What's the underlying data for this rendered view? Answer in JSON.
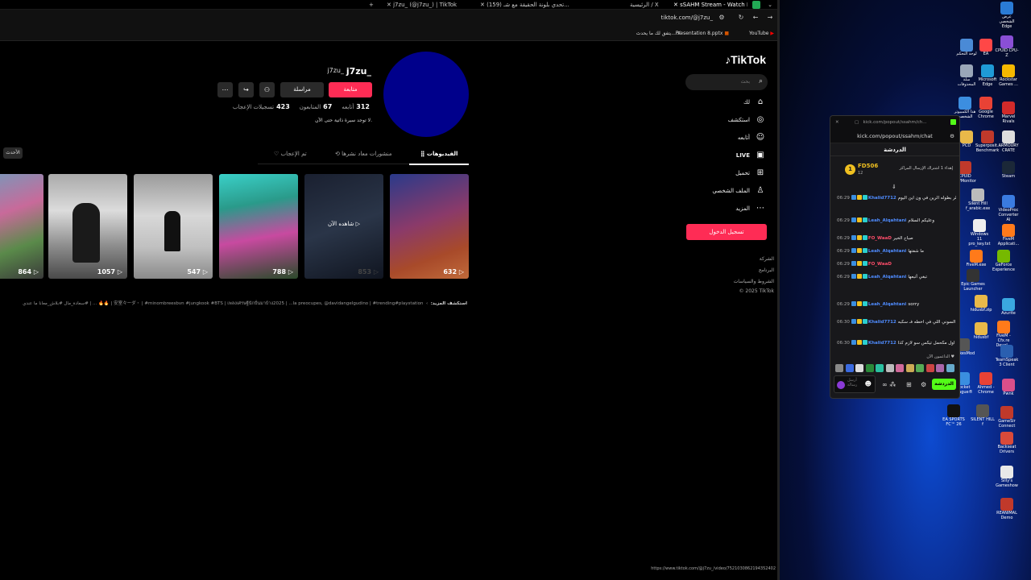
{
  "browser": {
    "tabs": [
      {
        "label": "j7zu_ (@j7zu_) | TikTok"
      },
      {
        "label": "(159) تحدي بلونة الحقيقة مع شـ..."
      },
      {
        "label": "الرئيسية / X"
      },
      {
        "label": "sSAHM Stream - Watch Live on"
      }
    ],
    "new_tab": "+",
    "url": "tiktok.com/@j7zu_",
    "bookmarks": [
      "YouTube",
      "Presentation 8.pptx",
      "يتفق لك ما يحدث..."
    ],
    "status_url": "https://www.tiktok.com/@j7zu_/video/7521030862194352402"
  },
  "tiktok": {
    "logo": "TikTok",
    "search_placeholder": "بحث",
    "nav": [
      {
        "label": "لك",
        "icon": "home-icon"
      },
      {
        "label": "استكشف",
        "icon": "compass-icon"
      },
      {
        "label": "أتابعه",
        "icon": "following-icon"
      },
      {
        "label": "LIVE",
        "icon": "live-icon"
      },
      {
        "label": "تحميل",
        "icon": "upload-icon"
      },
      {
        "label": "الملف الشخصي",
        "icon": "profile-icon"
      },
      {
        "label": "المزيد",
        "icon": "more-icon"
      }
    ],
    "login": "تسجيل الدخول",
    "footer": [
      "الشركة",
      "البرنامج",
      "الشروط والسياسات",
      "© 2025 TikTok"
    ],
    "profile": {
      "username": "j7zu_",
      "display_name": "j7zu_",
      "follow": "متابعة",
      "message": "مراسلة",
      "stats": [
        {
          "value": "312",
          "label": "أتابعه"
        },
        {
          "value": "67",
          "label": "المتابعون"
        },
        {
          "value": "423",
          "label": "تسجيلات الإعجاب"
        }
      ],
      "bio": "لا توجد سيرة ذاتية حتى الآن."
    },
    "tabs": [
      {
        "label": "الفيديوهات"
      },
      {
        "label": "منشورات معاد نشرها"
      },
      {
        "label": "تم الإعجاب"
      }
    ],
    "latest": "الأحدث",
    "videos": [
      {
        "views": "632",
        "overlay": ""
      },
      {
        "views": "853",
        "overlay": "شاهده الآن"
      },
      {
        "views": "788",
        "overlay": ""
      },
      {
        "views": "547",
        "overlay": ""
      },
      {
        "views": "1057",
        "overlay": ""
      },
      {
        "views": "864",
        "overlay": ""
      }
    ],
    "explore_label": "استكشف المزيد:",
    "explore_items": "安室々ーダ・ | #minombreesbvn #jungkook #BTS | เพลงเศรษฐีนักปั่นมาบ้าง2025 | ...la preocupes, @davidangelgudino | #trending#playstation | 🔥🔥 ... | #سعادة_مال #بلاش_معانا ما عندي"
  },
  "kick": {
    "title": "kick.com/popout/ssahm/ch...",
    "url": "kick.com/popout/ssahm/chat",
    "header": "الدردشة",
    "pinned_user": "FD506",
    "pinned_count": "12",
    "pinned_text": "إهداء 1 اشتراك الإرسال المراكز",
    "messages": [
      {
        "time": "06:29",
        "user": "Khalid7712",
        "text": "فـا انتظر بطوله الرين في ون اين اليوم",
        "color": "#4f8cff"
      },
      {
        "time": "06:29",
        "user": "Leah_Alqahtani",
        "text": "وعليكم السلام",
        "color": "#4f8cff"
      },
      {
        "time": "06:29",
        "user": "FO_WaaD",
        "text": "صباح الخير",
        "color": "#ff4d6a"
      },
      {
        "time": "06:29",
        "user": "Leah_Alqahtani",
        "text": "ما شفتها",
        "color": "#4f8cff"
      },
      {
        "time": "06:29",
        "user": "FO_WaaD",
        "text": "",
        "color": "#ff4d6a"
      },
      {
        "time": "06:29",
        "user": "Leah_Alqahtani",
        "text": "تبغي أتبعها",
        "color": "#4f8cff"
      },
      {
        "time": "06:29",
        "user": "Leah_Alqahtani",
        "text": "sorry",
        "color": "#4f8cff"
      },
      {
        "time": "06:30",
        "user": "Khalid7712",
        "text": "هذي حرقي محول بي بي ين السوني اللي في اخطه فـ سكبه",
        "color": "#4f8cff"
      },
      {
        "time": "06:30",
        "user": "Khalid7712",
        "text": "اول مكحمل تيكس سو لازم كذا",
        "color": "#4f8cff"
      }
    ],
    "supporters_label": "الداعمون الآن",
    "chat_button": "الدردشة",
    "input_placeholder": "أرسل رسالة"
  },
  "desktop_icons": [
    {
      "label": "عرض الشخصي Edge",
      "color": "#2a7bd6"
    },
    {
      "label": "لوحة التحكم",
      "color": "#4a8ad6"
    },
    {
      "label": "EA",
      "color": "#ff4747"
    },
    {
      "label": "CPUID CPU-Z",
      "color": "#8a4fd6"
    },
    {
      "label": "سلة المحذوفات",
      "color": "#9aa6b8"
    },
    {
      "label": "Microsoft Edge",
      "color": "#1f9ad6"
    },
    {
      "label": "Rockstar Games ...",
      "color": "#f5b800"
    },
    {
      "label": "هذا الكمبيوتر الشخصي",
      "color": "#3c8ee0"
    },
    {
      "label": "Google Chrome",
      "color": "#e94235"
    },
    {
      "label": "Marvel Rivals",
      "color": "#d22a2a"
    },
    {
      "label": "PCD",
      "color": "#e9b949"
    },
    {
      "label": "Superposit... Benchmark",
      "color": "#c0392b"
    },
    {
      "label": "ARMOURY CRATE",
      "color": "#ddd"
    },
    {
      "label": "CPUID HWMonitor",
      "color": "#c0392b"
    },
    {
      "label": "Steam",
      "color": "#1b2838"
    },
    {
      "label": "Silent Hill f_arabic.exe",
      "color": "#bbb"
    },
    {
      "label": "VideoProc Converter AI",
      "color": "#3a7be0"
    },
    {
      "label": "Windows 11 pro_key.txt",
      "color": "#eee"
    },
    {
      "label": "FiveM Applicati...",
      "color": "#ff7a1a"
    },
    {
      "label": "FiveM.exe",
      "color": "#ff7a1a"
    },
    {
      "label": "GeForce Experience",
      "color": "#76b900"
    },
    {
      "label": "Epic Games Launcher",
      "color": "#333"
    },
    {
      "label": "hidusbf.zip",
      "color": "#e9b949"
    },
    {
      "label": "Azurite",
      "color": "#3aa8e0"
    },
    {
      "label": "BakkesMod",
      "color": "#555"
    },
    {
      "label": "hidusbf",
      "color": "#e9b949"
    },
    {
      "label": "FiveM - Cfx.re Devel...",
      "color": "#ff7a1a"
    },
    {
      "label": "TeamSpeak 3 Client",
      "color": "#2a5fb0"
    },
    {
      "label": "Rocket League®",
      "color": "#3a8ee0"
    },
    {
      "label": "Ahmed - Chrome",
      "color": "#e94235"
    },
    {
      "label": "Pwnk",
      "color": "#d94f8a"
    },
    {
      "label": "EA SPORTS FC™ 26",
      "color": "#111"
    },
    {
      "label": "SILENT HILL f",
      "color": "#555"
    },
    {
      "label": "GameSir Connect",
      "color": "#c0392b"
    },
    {
      "label": "Backseat Drivers",
      "color": "#d94a3a"
    },
    {
      "label": "Silly's Gameshow",
      "color": "#e9e9e9"
    },
    {
      "label": "REANIMAL Demo",
      "color": "#c0392b"
    }
  ]
}
